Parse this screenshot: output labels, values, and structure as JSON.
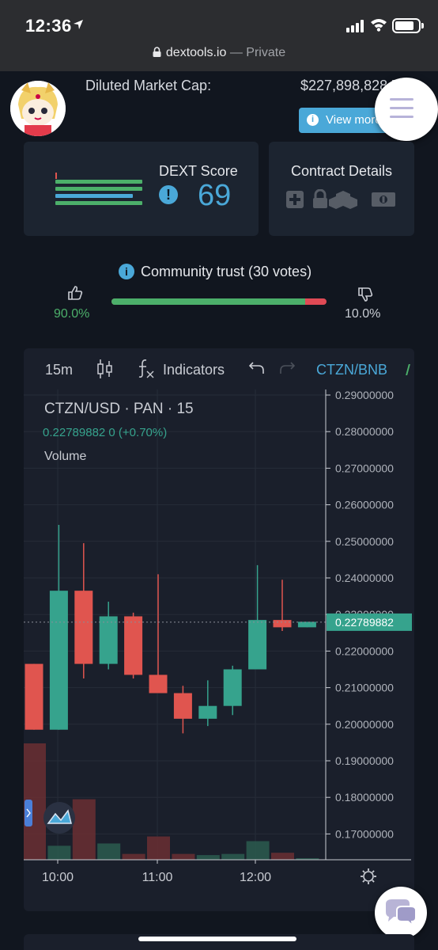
{
  "status_bar": {
    "time": "12:36"
  },
  "browser": {
    "domain": "dextools.io",
    "mode": "— Private"
  },
  "header": {
    "market_cap_label": "Diluted Market Cap:",
    "market_cap_value": "$227,898,828.79",
    "view_more_label": "View more"
  },
  "dext_score": {
    "title": "DEXT Score",
    "warning_icon": "!",
    "score": "69"
  },
  "contract": {
    "title": "Contract Details",
    "icons": [
      "plus-icon",
      "lock-icon",
      "cubes-icon",
      "cash-icon"
    ]
  },
  "community_trust": {
    "title": "Community trust (30 votes)",
    "positive": "90.0%",
    "negative": "10.0%",
    "positive_fraction": 0.9
  },
  "chart_toolbar": {
    "interval": "15m",
    "indicators_label": "Indicators",
    "pair": "CTZN/BNB"
  },
  "chart_legend": {
    "symbol": "CTZN/USD · PAN · 15",
    "price_line": "0.22789882  0 (+0.70%)",
    "volume_label": "Volume"
  },
  "chart_data": {
    "type": "candlestick",
    "x_tick_labels": [
      "10:00",
      "11:00",
      "12:00"
    ],
    "y_tick_labels": [
      "0.29000000",
      "0.28000000",
      "0.27000000",
      "0.26000000",
      "0.25000000",
      "0.24000000",
      "0.23000000",
      "0.22000000",
      "0.21000000",
      "0.20000000",
      "0.19000000",
      "0.18000000",
      "0.17000000"
    ],
    "ylim": [
      0.163,
      0.292
    ],
    "current_price_label": "0.22789882",
    "current_price": 0.22789882,
    "colors": {
      "up": "#36a38d",
      "down": "#e0554f"
    },
    "candles": [
      {
        "o": 0.2165,
        "h": 0.2165,
        "l": 0.1985,
        "c": 0.1985,
        "v": 1.0
      },
      {
        "o": 0.1985,
        "h": 0.2545,
        "l": 0.1985,
        "c": 0.2365,
        "v": 0.12
      },
      {
        "o": 0.2365,
        "h": 0.2495,
        "l": 0.2125,
        "c": 0.2165,
        "v": 0.52
      },
      {
        "o": 0.2165,
        "h": 0.2335,
        "l": 0.215,
        "c": 0.2295,
        "v": 0.14
      },
      {
        "o": 0.2295,
        "h": 0.2305,
        "l": 0.2125,
        "c": 0.2135,
        "v": 0.05
      },
      {
        "o": 0.2135,
        "h": 0.241,
        "l": 0.209,
        "c": 0.2085,
        "v": 0.2
      },
      {
        "o": 0.2085,
        "h": 0.2105,
        "l": 0.1975,
        "c": 0.2015,
        "v": 0.05
      },
      {
        "o": 0.2015,
        "h": 0.212,
        "l": 0.1995,
        "c": 0.205,
        "v": 0.04
      },
      {
        "o": 0.205,
        "h": 0.216,
        "l": 0.2025,
        "c": 0.215,
        "v": 0.05
      },
      {
        "o": 0.215,
        "h": 0.2435,
        "l": 0.215,
        "c": 0.2285,
        "v": 0.16
      },
      {
        "o": 0.2285,
        "h": 0.2395,
        "l": 0.2255,
        "c": 0.2265,
        "v": 0.06
      },
      {
        "o": 0.2265,
        "h": 0.228,
        "l": 0.2265,
        "c": 0.228,
        "v": 0.01
      }
    ]
  }
}
